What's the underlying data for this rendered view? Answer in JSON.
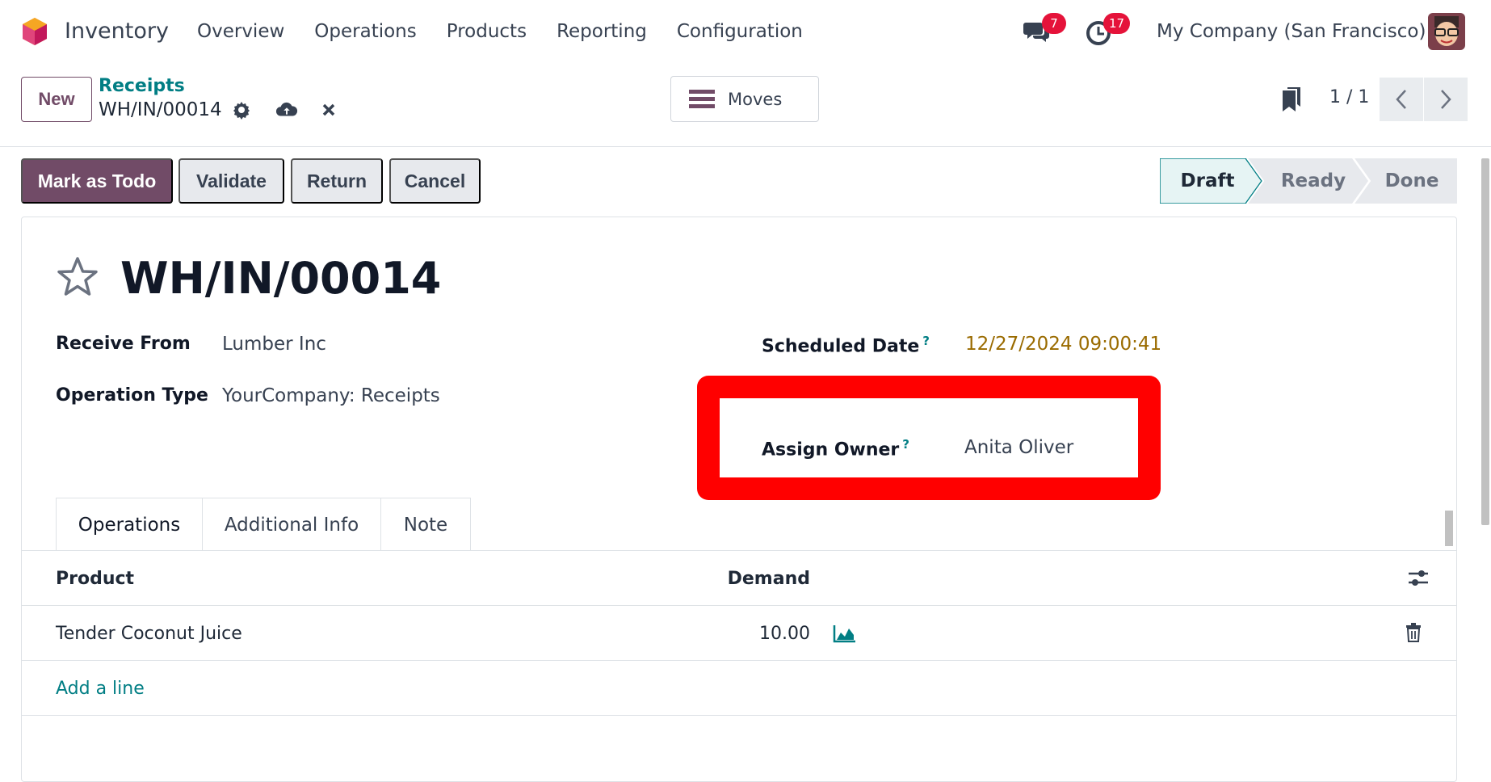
{
  "topbar": {
    "app_name": "Inventory",
    "menu": [
      "Overview",
      "Operations",
      "Products",
      "Reporting",
      "Configuration"
    ],
    "messages_badge": "7",
    "activities_badge": "17",
    "company": "My Company (San Francisco)"
  },
  "controlbar": {
    "new_label": "New",
    "breadcrumb": "Receipts",
    "record_name": "WH/IN/00014",
    "moves_label": "Moves",
    "pager": "1 / 1"
  },
  "actions": {
    "mark_todo": "Mark as Todo",
    "validate": "Validate",
    "return": "Return",
    "cancel": "Cancel"
  },
  "status": [
    "Draft",
    "Ready",
    "Done"
  ],
  "form": {
    "title": "WH/IN/00014",
    "receive_from_label": "Receive From",
    "receive_from_value": "Lumber Inc",
    "operation_type_label": "Operation Type",
    "operation_type_value": "YourCompany: Receipts",
    "scheduled_date_label": "Scheduled Date",
    "scheduled_date_value": "12/27/2024 09:00:41",
    "assign_owner_label": "Assign Owner",
    "assign_owner_value": "Anita Oliver",
    "help_mark": "?"
  },
  "tabs": [
    "Operations",
    "Additional Info",
    "Note"
  ],
  "table": {
    "col_product": "Product",
    "col_demand": "Demand",
    "rows": [
      {
        "product": "Tender Coconut Juice",
        "demand": "10.00"
      }
    ],
    "add_line": "Add a line"
  },
  "colors": {
    "brand": "#714b67",
    "accent": "#017e84",
    "badge": "#e5133a",
    "highlight": "#ff0000"
  }
}
